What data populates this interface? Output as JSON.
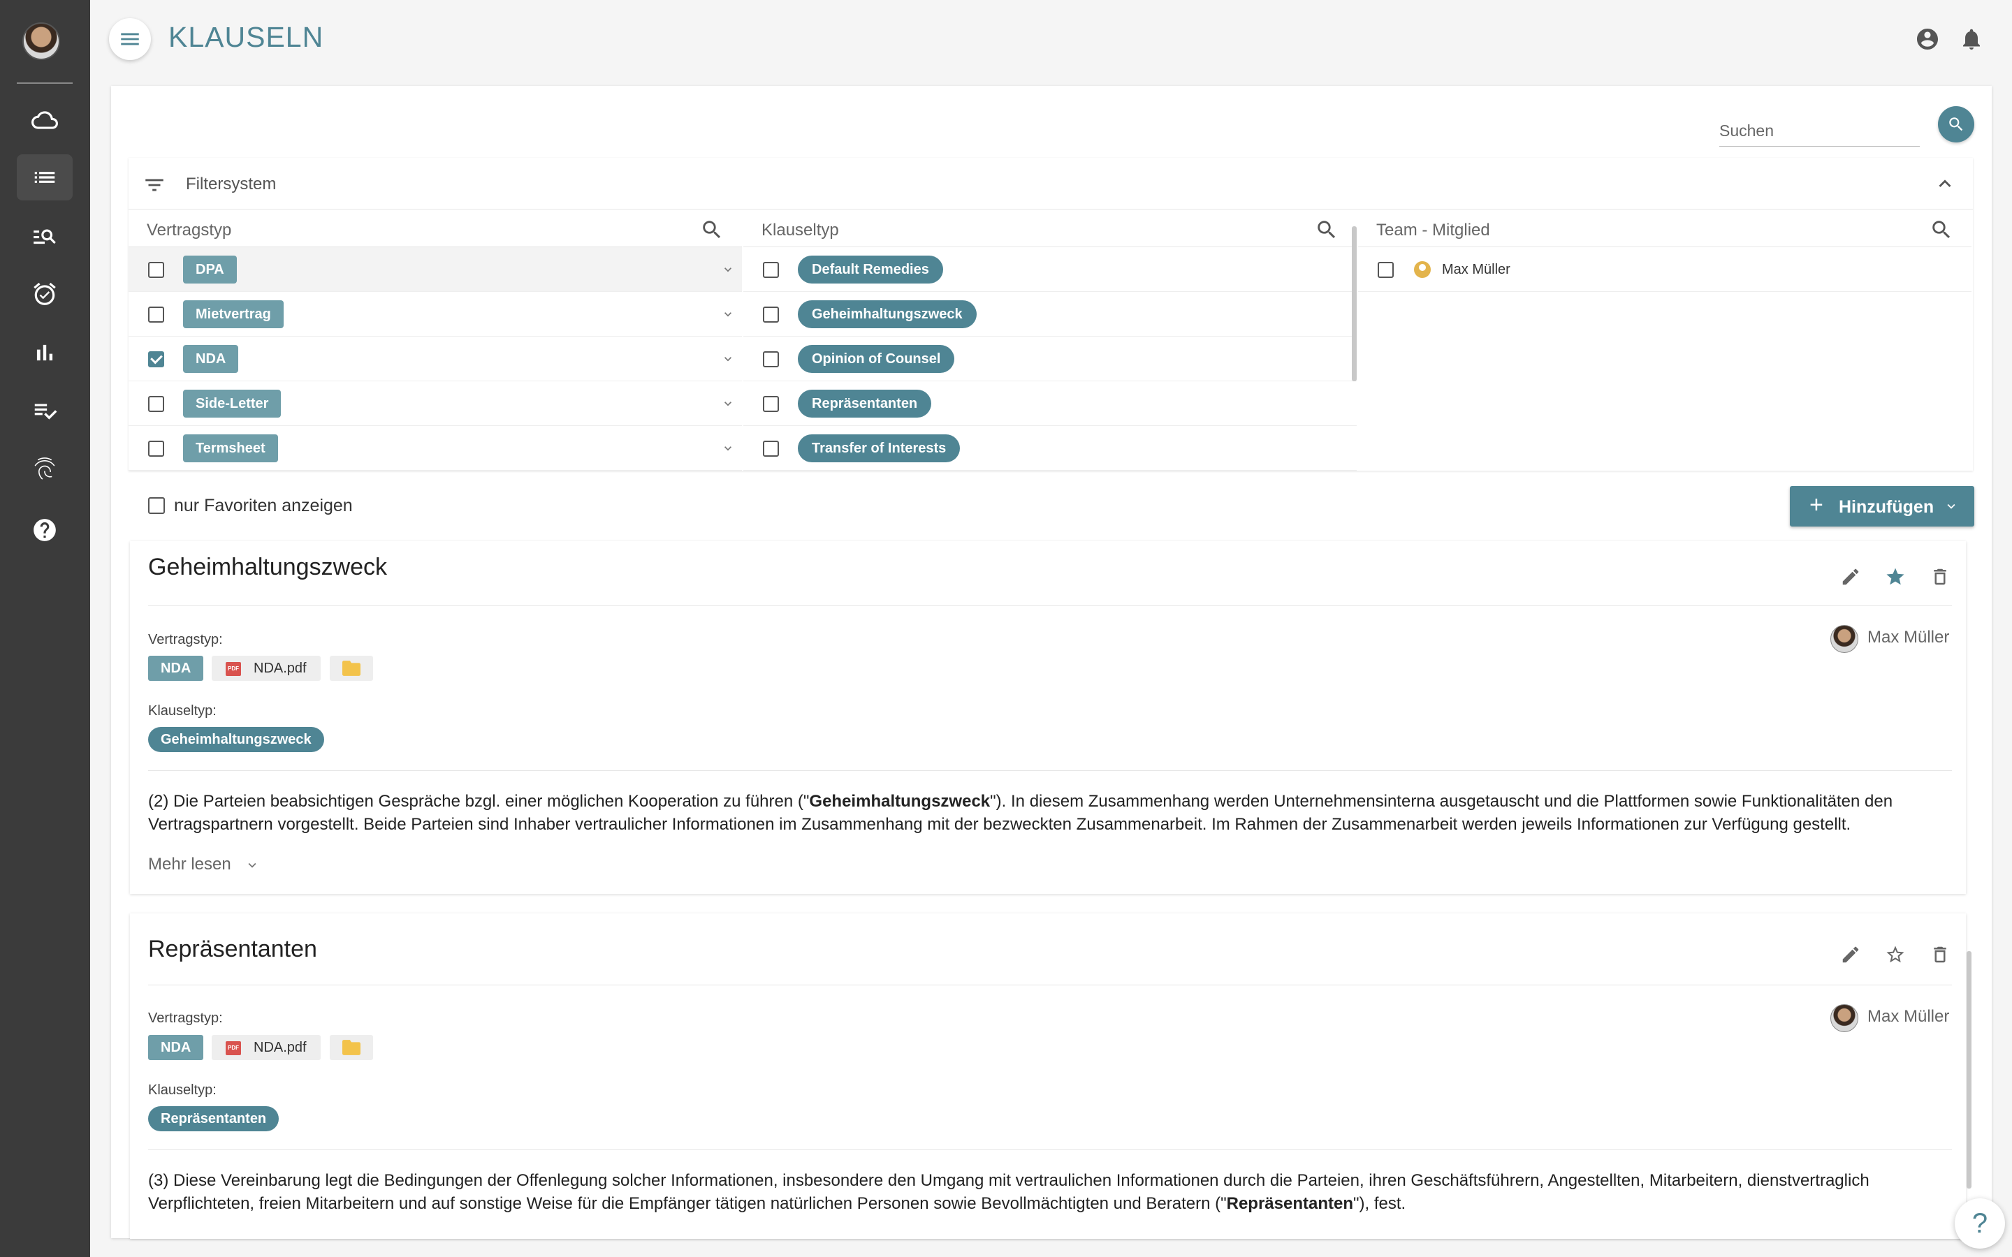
{
  "header": {
    "title": "KLAUSELN"
  },
  "search": {
    "placeholder": "Suchen"
  },
  "filter": {
    "title": "Filtersystem",
    "columns": {
      "vertragstyp": {
        "label": "Vertragstyp",
        "items": [
          {
            "label": "DPA",
            "checked": false
          },
          {
            "label": "Mietvertrag",
            "checked": false
          },
          {
            "label": "NDA",
            "checked": true
          },
          {
            "label": "Side-Letter",
            "checked": false
          },
          {
            "label": "Termsheet",
            "checked": false
          }
        ]
      },
      "klauseltyp": {
        "label": "Klauseltyp",
        "items": [
          {
            "label": "Default Remedies"
          },
          {
            "label": "Geheimhaltungszweck"
          },
          {
            "label": "Opinion of Counsel"
          },
          {
            "label": "Repräsentanten"
          },
          {
            "label": "Transfer of Interests"
          }
        ]
      },
      "team": {
        "label": "Team - Mitglied",
        "items": [
          {
            "label": "Max Müller"
          }
        ]
      }
    },
    "favorites_label": "nur Favoriten anzeigen",
    "add_label": "Hinzufügen"
  },
  "clauses": [
    {
      "title": "Geheimhaltungszweck",
      "owner": "Max Müller",
      "vertragstyp_label": "Vertragstyp:",
      "vertragstyp": "NDA",
      "file": "NDA.pdf",
      "klauseltyp_label": "Klauseltyp:",
      "klauseltyp": "Geheimhaltungszweck",
      "favorite": true,
      "text_before": "(2) Die Parteien beabsichtigen Gespräche bzgl. einer möglichen Kooperation zu führen (\"",
      "text_bold": "Geheimhaltungszweck",
      "text_after": "\"). In diesem Zusammenhang werden Unternehmensinterna ausgetauscht und die Plattformen sowie Funktionalitäten den Vertragspartnern vorgestellt. Beide Parteien sind Inhaber vertraulicher Informationen im Zusammenhang mit der bezweckten Zusammenarbeit. Im Rahmen der Zusammenarbeit werden jeweils Informationen zur Verfügung gestellt.",
      "more_label": "Mehr lesen"
    },
    {
      "title": "Repräsentanten",
      "owner": "Max Müller",
      "vertragstyp_label": "Vertragstyp:",
      "vertragstyp": "NDA",
      "file": "NDA.pdf",
      "klauseltyp_label": "Klauseltyp:",
      "klauseltyp": "Repräsentanten",
      "favorite": false,
      "text_before": "(3) Diese Vereinbarung legt die Bedingungen der Offenlegung solcher Informationen, insbesondere den Umgang mit vertraulichen Informationen durch die Parteien, ihren Geschäftsführern, Angestellten, Mitarbeitern, dienstvertraglich Verpflichteten, freien Mitarbeitern und auf sonstige Weise für die Empfänger tätigen natürlichen Personen sowie Bevollmächtigten und Beratern (\"",
      "text_bold": "Repräsentanten",
      "text_after": "\"), fest."
    }
  ],
  "help": {
    "label": "?"
  },
  "colors": {
    "accent": "#4f8594",
    "tag": "#6f9ea9",
    "sidebar": "#3b3b3b"
  }
}
